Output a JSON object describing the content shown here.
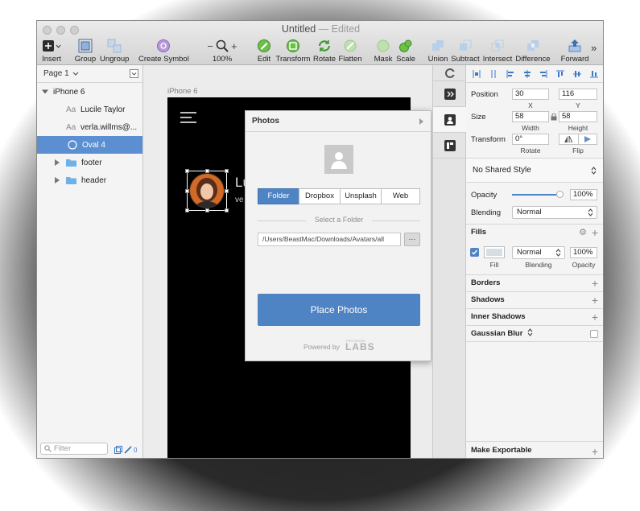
{
  "window": {
    "title": "Untitled",
    "title_suffix": "— Edited"
  },
  "toolbar": {
    "insert": "Insert",
    "group": "Group",
    "ungroup": "Ungroup",
    "create_symbol": "Create Symbol",
    "zoom": "100%",
    "zoom_minus": "−",
    "zoom_plus": "+",
    "edit": "Edit",
    "transform": "Transform",
    "rotate": "Rotate",
    "flatten": "Flatten",
    "mask": "Mask",
    "scale": "Scale",
    "union": "Union",
    "subtract": "Subtract",
    "intersect": "Intersect",
    "difference": "Difference",
    "forward": "Forward",
    "more": "»"
  },
  "layers": {
    "page": "Page 1",
    "artboard": "iPhone 6",
    "items": [
      {
        "icon": "Aa",
        "label": "Lucile Taylor"
      },
      {
        "icon": "Aa",
        "label": "verla.willms@..."
      },
      {
        "icon": "circle",
        "label": "Oval 4",
        "selected": true
      },
      {
        "icon": "folder",
        "label": "footer"
      },
      {
        "icon": "folder",
        "label": "header"
      }
    ],
    "filter_placeholder": "Filter",
    "badge_count": "0"
  },
  "canvas": {
    "artboard_label": "iPhone 6",
    "name_partial": "Lu",
    "email_partial": "ve"
  },
  "photos_panel": {
    "title": "Photos",
    "tabs": [
      "Folder",
      "Dropbox",
      "Unsplash",
      "Web"
    ],
    "active_tab": "Folder",
    "select_label": "Select a Folder",
    "path": "/Users/BeastMac/Downloads/Avatars/all",
    "browse": "···",
    "place_button": "Place Photos",
    "powered_by": "Powered by",
    "brand_top": "INVISION",
    "brand": "LABS"
  },
  "inspector": {
    "position_label": "Position",
    "x": "30",
    "y": "116",
    "x_label": "X",
    "y_label": "Y",
    "size_label": "Size",
    "width": "58",
    "height": "58",
    "width_label": "Width",
    "height_label": "Height",
    "transform_label": "Transform",
    "rotate_value": "0°",
    "rotate_label": "Rotate",
    "flip_label": "Flip",
    "shared_style": "No Shared Style",
    "opacity_label": "Opacity",
    "opacity_value": "100%",
    "opacity_fraction": 1.0,
    "blending_label": "Blending",
    "blending_value": "Normal",
    "fills_title": "Fills",
    "fill_blending": "Normal",
    "fill_opacity": "100%",
    "fill_sub": "Fill",
    "fill_blend_sub": "Blending",
    "fill_opacity_sub": "Opacity",
    "borders": "Borders",
    "shadows": "Shadows",
    "inner_shadows": "Inner Shadows",
    "gaussian_blur": "Gaussian Blur",
    "make_exportable": "Make Exportable",
    "plus": "+"
  },
  "colors": {
    "accent": "#4e83c4",
    "selection": "#5b8fd2",
    "fill_swatch": "#d8dde2"
  }
}
